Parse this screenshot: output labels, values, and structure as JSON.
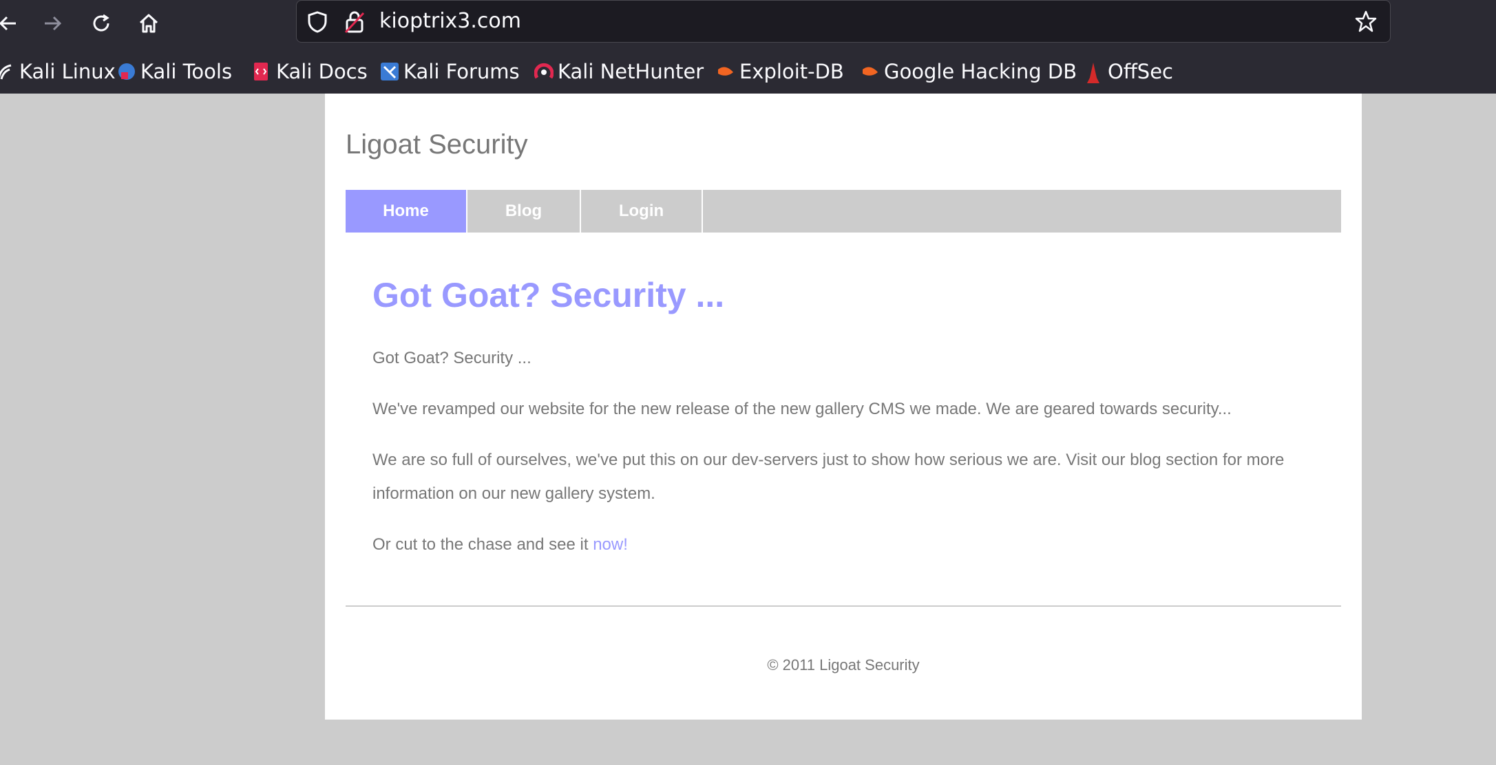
{
  "browser": {
    "url": "kioptrix3.com",
    "bookmarks": [
      {
        "label": "Kali Linux",
        "icon": "kali-dragon-icon"
      },
      {
        "label": "Kali Tools",
        "icon": "kali-tools-icon"
      },
      {
        "label": "Kali Docs",
        "icon": "kali-docs-icon"
      },
      {
        "label": "Kali Forums",
        "icon": "kali-forums-icon"
      },
      {
        "label": "Kali NetHunter",
        "icon": "kali-nethunter-icon"
      },
      {
        "label": "Exploit-DB",
        "icon": "exploit-db-icon"
      },
      {
        "label": "Google Hacking DB",
        "icon": "ghdb-icon"
      },
      {
        "label": "OffSec",
        "icon": "offsec-icon"
      }
    ]
  },
  "site": {
    "title": "Ligoat Security",
    "menu": [
      "Home",
      "Blog",
      "Login"
    ],
    "active_menu": "Home",
    "accent_color": "#9999ff"
  },
  "content": {
    "heading": "Got Goat? Security ...",
    "p1": "Got Goat? Security ...",
    "p2": "We've revamped our website for the new release of the new gallery CMS we made. We are geared towards security...",
    "p3": "We are so full of ourselves, we've put this on our dev-servers just to show how serious we are. Visit our blog section for more information on our new gallery system.",
    "p4_text": "Or cut to the chase and see it ",
    "p4_link": "now!"
  },
  "footer": {
    "text": "© 2011 Ligoat Security"
  }
}
